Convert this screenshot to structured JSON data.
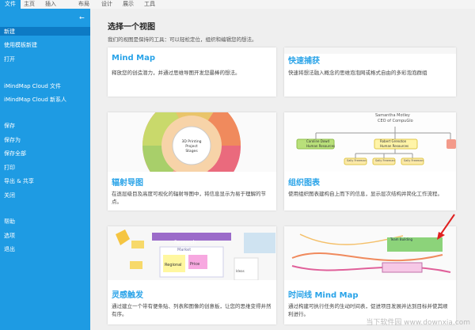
{
  "topbar": {
    "tabs": [
      "文件",
      "主页",
      "插入",
      "布局",
      "设计",
      "展示",
      "工具"
    ]
  },
  "sidebar": {
    "back_glyph": "←",
    "items": [
      "新建",
      "使用模板新建",
      "打开",
      "iMindMap Cloud 文件",
      "iMindMap Cloud 新系人",
      "保存",
      "保存为",
      "保存全部",
      "打印",
      "导出 & 共享",
      "关闭",
      "帮助",
      "选项",
      "退出"
    ]
  },
  "main": {
    "title": "选择一个视图",
    "subtitle": "我们的视图是保持的工具：可以轻松定位，组织和编辑您的想法。",
    "cards": [
      {
        "name": "Mind Map",
        "desc": "释放您的创造潜力，并通过思维导图开发您最棒的想法。"
      },
      {
        "name": "快速捕获",
        "desc": "快速将想法融入概念的思维泡泡网或格式自由的多彩泡泡群组"
      },
      {
        "name": "辐射导图",
        "desc": "在逐层级目及高度可视化的辐射导图中，将信息显示为易于理解的节点。",
        "center_label": "3D Printing Project Stages"
      },
      {
        "name": "组织图表",
        "desc": "使用组织图表建构自上而下的信息，显示层次结构并简化工作流程。",
        "top_name": "Samantha Motley",
        "top_role": "CEO of CompuGlo",
        "mid_name": "Caroline Dowd",
        "mid_role": "Human Resources",
        "node_a": "Robert Grenoton",
        "node_b": "Sally Freeman"
      },
      {
        "name": "灵感触发",
        "desc": "通过建立一个带有便条贴、列表和图像的创意板，让您的思维变得井然有序。",
        "board_title": "Research",
        "market": "Market",
        "regional": "Regional",
        "price": "Price",
        "ideas": "Ideas"
      },
      {
        "name": "时间线 Mind Map",
        "desc": "通过构建可执行任务的生动时间表，促进项目发展并达到目标并使其顺利进行。",
        "task": "Team Building"
      }
    ]
  },
  "watermark": "当下软件园 www.downxia.com",
  "colors": {
    "accent": "#1e9be3",
    "selected": "#0d7ac4",
    "card_title": "#29a3e8"
  }
}
